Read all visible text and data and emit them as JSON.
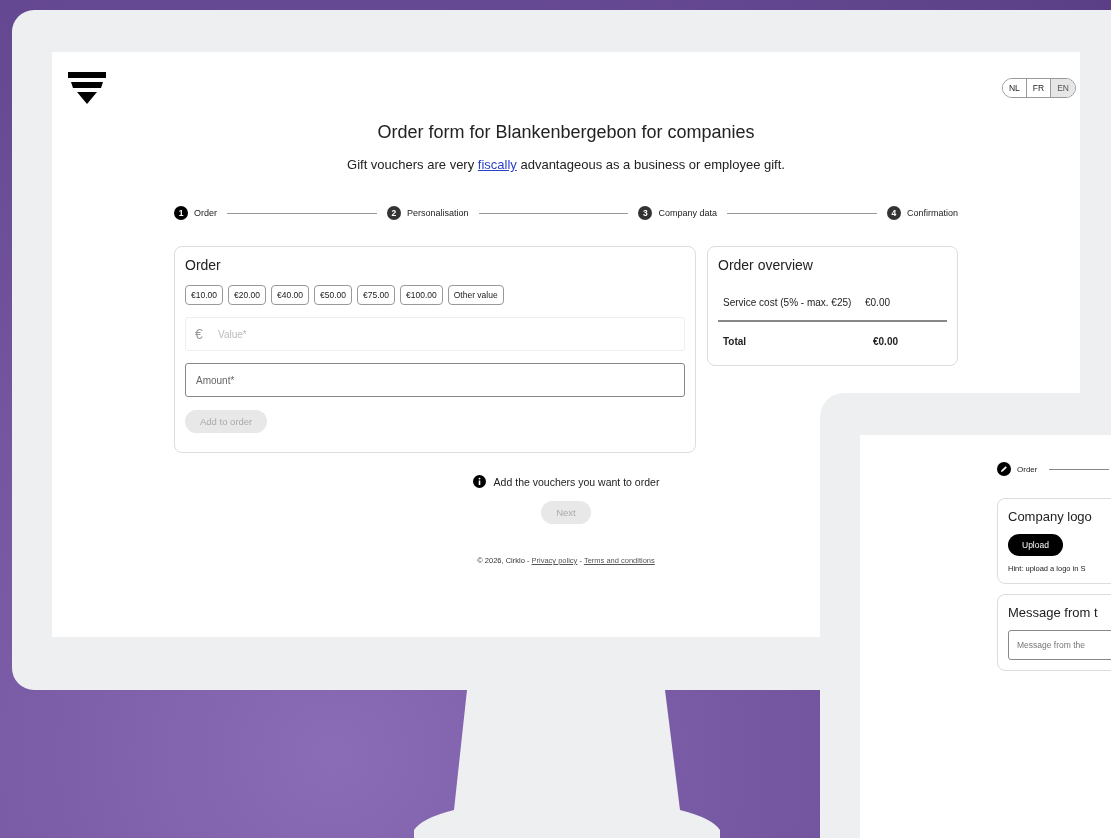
{
  "languages": [
    {
      "label": "NL",
      "selected": false
    },
    {
      "label": "FR",
      "selected": false
    },
    {
      "label": "EN",
      "selected": true
    }
  ],
  "title": "Order form for Blankenbergebon for companies",
  "subtitle": {
    "before": "Gift vouchers are very",
    "link": "fiscally",
    "after": "advantageous as a business or employee gift."
  },
  "steps": [
    {
      "number": "1",
      "label": "Order",
      "selected": true
    },
    {
      "number": "2",
      "label": "Personalisation",
      "selected": false
    },
    {
      "number": "3",
      "label": "Company data",
      "selected": false
    },
    {
      "number": "4",
      "label": "Confirmation",
      "selected": false
    }
  ],
  "order_card": {
    "title": "Order",
    "values": [
      "€10.00",
      "€20.00",
      "€40.00",
      "€50.00",
      "€75.00",
      "€100.00",
      "Other value"
    ],
    "value_field": {
      "prefix": "€",
      "placeholder": "Value*",
      "disabled": true
    },
    "amount_field": {
      "placeholder": "Amount*"
    },
    "add_button": {
      "label": "Add to order",
      "disabled": true
    }
  },
  "overview": {
    "title": "Order overview",
    "rows": [
      {
        "label": "Service cost (5% - max. €25)",
        "value": "€0.00"
      }
    ],
    "total": {
      "label": "Total",
      "value": "€0.00"
    }
  },
  "info": "Add the vouchers you want to order",
  "next_button": {
    "label": "Next",
    "disabled": true
  },
  "footer": {
    "copyright": "© 2026, Cirklo",
    "separator": "-",
    "links": [
      "Privacy policy",
      "Terms and conditions"
    ]
  },
  "tablet": {
    "step": "Order",
    "logo_card": {
      "title": "Company logo",
      "button": "Upload",
      "hint": "Hint: upload a logo in S"
    },
    "message_card": {
      "title": "Message from t",
      "placeholder": "Message from the"
    }
  }
}
